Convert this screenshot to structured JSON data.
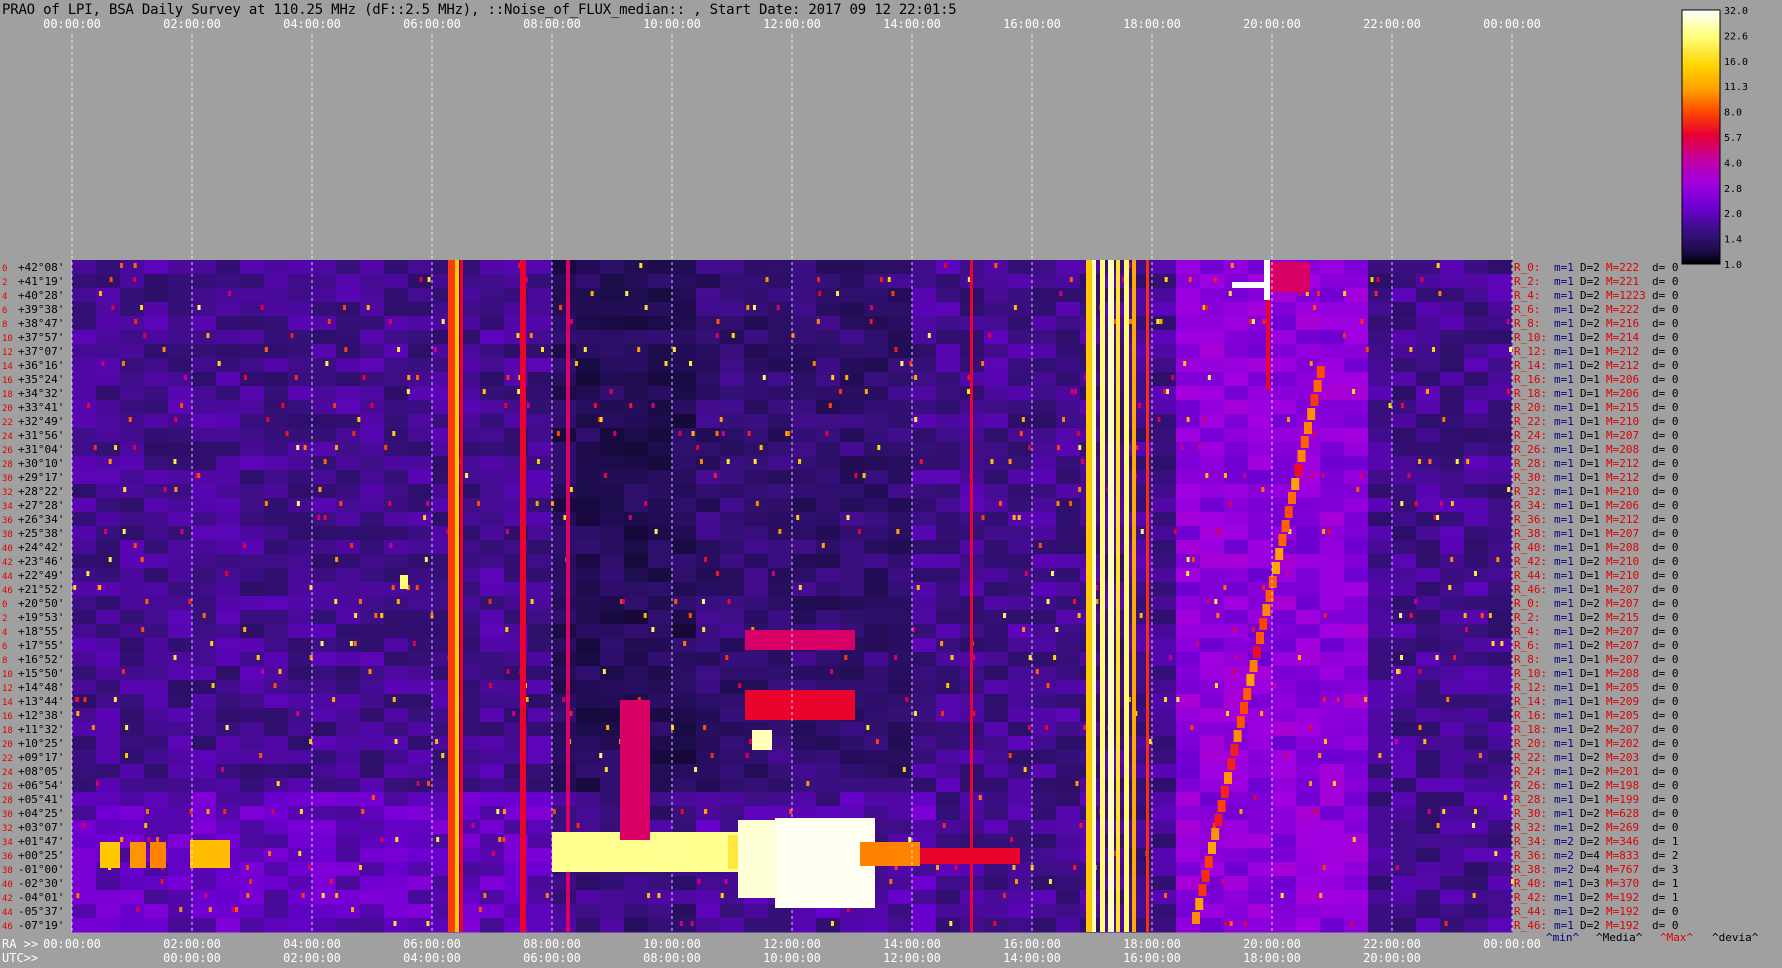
{
  "title": "PRAO of LPI, BSA Daily Survey at 110.25 MHz (dF::2.5 MHz), ::Noise_of_FLUX_median:: , Start Date: 2017 09 12 22:01:5",
  "time_axis": {
    "top_ticks": [
      "00:00:00",
      "02:00:00",
      "04:00:00",
      "06:00:00",
      "08:00:00",
      "10:00:00",
      "12:00:00",
      "14:00:00",
      "16:00:00",
      "18:00:00",
      "20:00:00",
      "22:00:00",
      "00:00:00"
    ],
    "ra_label": "RA >>",
    "ra_ticks": [
      "00:00:00",
      "02:00:00",
      "04:00:00",
      "06:00:00",
      "08:00:00",
      "10:00:00",
      "12:00:00",
      "14:00:00",
      "16:00:00",
      "18:00:00",
      "20:00:00",
      "22:00:00",
      "00:00:00"
    ],
    "utc_label": "UTC>>",
    "utc_ticks": [
      "00:00:00",
      "02:00:00",
      "04:00:00",
      "06:00:00",
      "08:00:00",
      "10:00:00",
      "12:00:00",
      "14:00:00",
      "16:00:00",
      "18:00:00",
      "20:00:00"
    ]
  },
  "row_indices": [
    "0",
    "2",
    "4",
    "6",
    "8",
    "10",
    "12",
    "14",
    "16",
    "18",
    "20",
    "22",
    "24",
    "26",
    "28",
    "30",
    "32",
    "34",
    "36",
    "38",
    "40",
    "42",
    "44",
    "46",
    "0",
    "2",
    "4",
    "6",
    "8",
    "10",
    "12",
    "14",
    "16",
    "18",
    "20",
    "22",
    "24",
    "26",
    "28",
    "30",
    "32",
    "34",
    "36",
    "38",
    "40",
    "42",
    "44",
    "46"
  ],
  "declinations": [
    "+42°08'",
    "+41°19'",
    "+40°28'",
    "+39°38'",
    "+38°47'",
    "+37°57'",
    "+37°07'",
    "+36°16'",
    "+35°24'",
    "+34°32'",
    "+33°41'",
    "+32°49'",
    "+31°56'",
    "+31°04'",
    "+30°10'",
    "+29°17'",
    "+28°22'",
    "+27°28'",
    "+26°34'",
    "+25°38'",
    "+24°42'",
    "+23°46'",
    "+22°49'",
    "+21°52'",
    "+20°50'",
    "+19°53'",
    "+18°55'",
    "+17°55'",
    "+16°52'",
    "+15°50'",
    "+14°48'",
    "+13°44'",
    "+12°38'",
    "+11°32'",
    "+10°25'",
    "+09°17'",
    "+08°05'",
    "+06°54'",
    "+05°41'",
    "+04°25'",
    "+03°07'",
    "+01°47'",
    "+00°25'",
    "-01°00'",
    "-02°30'",
    "-04°01'",
    "-05°37'",
    "-07°19'"
  ],
  "beam_stats": [
    {
      "r": "R_0:",
      "m": "m=1",
      "d": "D=2",
      "M": "M=222",
      "dev": "d= 0"
    },
    {
      "r": "R_2:",
      "m": "m=1",
      "d": "D=2",
      "M": "M=221",
      "dev": "d= 0"
    },
    {
      "r": "R_4:",
      "m": "m=1",
      "d": "D=2",
      "M": "M=1223",
      "dev": "d= 0"
    },
    {
      "r": "R_6:",
      "m": "m=1",
      "d": "D=2",
      "M": "M=222",
      "dev": "d= 0"
    },
    {
      "r": "R_8:",
      "m": "m=1",
      "d": "D=2",
      "M": "M=216",
      "dev": "d= 0"
    },
    {
      "r": "R_10:",
      "m": "m=1",
      "d": "D=2",
      "M": "M=214",
      "dev": "d= 0"
    },
    {
      "r": "R_12:",
      "m": "m=1",
      "d": "D=1",
      "M": "M=212",
      "dev": "d= 0"
    },
    {
      "r": "R_14:",
      "m": "m=1",
      "d": "D=2",
      "M": "M=212",
      "dev": "d= 0"
    },
    {
      "r": "R_16:",
      "m": "m=1",
      "d": "D=1",
      "M": "M=206",
      "dev": "d= 0"
    },
    {
      "r": "R_18:",
      "m": "m=1",
      "d": "D=1",
      "M": "M=206",
      "dev": "d= 0"
    },
    {
      "r": "R_20:",
      "m": "m=1",
      "d": "D=1",
      "M": "M=215",
      "dev": "d= 0"
    },
    {
      "r": "R_22:",
      "m": "m=1",
      "d": "D=1",
      "M": "M=210",
      "dev": "d= 0"
    },
    {
      "r": "R_24:",
      "m": "m=1",
      "d": "D=1",
      "M": "M=207",
      "dev": "d= 0"
    },
    {
      "r": "R_26:",
      "m": "m=1",
      "d": "D=1",
      "M": "M=208",
      "dev": "d= 0"
    },
    {
      "r": "R_28:",
      "m": "m=1",
      "d": "D=1",
      "M": "M=212",
      "dev": "d= 0"
    },
    {
      "r": "R_30:",
      "m": "m=1",
      "d": "D=1",
      "M": "M=212",
      "dev": "d= 0"
    },
    {
      "r": "R_32:",
      "m": "m=1",
      "d": "D=1",
      "M": "M=210",
      "dev": "d= 0"
    },
    {
      "r": "R_34:",
      "m": "m=1",
      "d": "D=1",
      "M": "M=206",
      "dev": "d= 0"
    },
    {
      "r": "R_36:",
      "m": "m=1",
      "d": "D=1",
      "M": "M=212",
      "dev": "d= 0"
    },
    {
      "r": "R_38:",
      "m": "m=1",
      "d": "D=1",
      "M": "M=207",
      "dev": "d= 0"
    },
    {
      "r": "R_40:",
      "m": "m=1",
      "d": "D=1",
      "M": "M=208",
      "dev": "d= 0"
    },
    {
      "r": "R_42:",
      "m": "m=1",
      "d": "D=2",
      "M": "M=210",
      "dev": "d= 0"
    },
    {
      "r": "R_44:",
      "m": "m=1",
      "d": "D=1",
      "M": "M=210",
      "dev": "d= 0"
    },
    {
      "r": "R_46:",
      "m": "m=1",
      "d": "D=1",
      "M": "M=207",
      "dev": "d= 0"
    },
    {
      "r": "R_0:",
      "m": "m=1",
      "d": "D=2",
      "M": "M=207",
      "dev": "d= 0"
    },
    {
      "r": "R_2:",
      "m": "m=1",
      "d": "D=2",
      "M": "M=215",
      "dev": "d= 0"
    },
    {
      "r": "R_4:",
      "m": "m=1",
      "d": "D=2",
      "M": "M=207",
      "dev": "d= 0"
    },
    {
      "r": "R_6:",
      "m": "m=1",
      "d": "D=2",
      "M": "M=207",
      "dev": "d= 0"
    },
    {
      "r": "R_8:",
      "m": "m=1",
      "d": "D=1",
      "M": "M=207",
      "dev": "d= 0"
    },
    {
      "r": "R_10:",
      "m": "m=1",
      "d": "D=1",
      "M": "M=208",
      "dev": "d= 0"
    },
    {
      "r": "R_12:",
      "m": "m=1",
      "d": "D=1",
      "M": "M=205",
      "dev": "d= 0"
    },
    {
      "r": "R_14:",
      "m": "m=1",
      "d": "D=1",
      "M": "M=209",
      "dev": "d= 0"
    },
    {
      "r": "R_16:",
      "m": "m=1",
      "d": "D=1",
      "M": "M=205",
      "dev": "d= 0"
    },
    {
      "r": "R_18:",
      "m": "m=1",
      "d": "D=2",
      "M": "M=207",
      "dev": "d= 0"
    },
    {
      "r": "R_20:",
      "m": "m=1",
      "d": "D=1",
      "M": "M=202",
      "dev": "d= 0"
    },
    {
      "r": "R_22:",
      "m": "m=1",
      "d": "D=2",
      "M": "M=203",
      "dev": "d= 0"
    },
    {
      "r": "R_24:",
      "m": "m=1",
      "d": "D=2",
      "M": "M=201",
      "dev": "d= 0"
    },
    {
      "r": "R_26:",
      "m": "m=1",
      "d": "D=2",
      "M": "M=198",
      "dev": "d= 0"
    },
    {
      "r": "R_28:",
      "m": "m=1",
      "d": "D=1",
      "M": "M=199",
      "dev": "d= 0"
    },
    {
      "r": "R_30:",
      "m": "m=1",
      "d": "D=2",
      "M": "M=628",
      "dev": "d= 0"
    },
    {
      "r": "R_32:",
      "m": "m=1",
      "d": "D=2",
      "M": "M=269",
      "dev": "d= 0"
    },
    {
      "r": "R_34:",
      "m": "m=2",
      "d": "D=2",
      "M": "M=346",
      "dev": "d= 1"
    },
    {
      "r": "R_36:",
      "m": "m=2",
      "d": "D=4",
      "M": "M=833",
      "dev": "d= 2"
    },
    {
      "r": "R_38:",
      "m": "m=2",
      "d": "D=4",
      "M": "M=767",
      "dev": "d= 3"
    },
    {
      "r": "R_40:",
      "m": "m=1",
      "d": "D=3",
      "M": "M=370",
      "dev": "d= 1"
    },
    {
      "r": "R_42:",
      "m": "m=1",
      "d": "D=2",
      "M": "M=192",
      "dev": "d= 1"
    },
    {
      "r": "R_44:",
      "m": "m=1",
      "d": "D=2",
      "M": "M=192",
      "dev": "d= 0"
    },
    {
      "r": "R_46:",
      "m": "m=1",
      "d": "D=2",
      "M": "M=192",
      "dev": "d= 0"
    }
  ],
  "stats_legend": {
    "min": "^min^",
    "median": "^Media^",
    "max": "^Max^",
    "dev": "^devia^"
  },
  "colors": {
    "background": "#a0a0a0",
    "label_red": "#e00000",
    "label_navy": "#000080",
    "grid": "#ffffff",
    "dec_label": "#000000"
  },
  "colorbar": {
    "ticks": [
      "32.0",
      "22.6",
      "16.0",
      "11.3",
      "8.0",
      "5.7",
      "4.0",
      "2.8",
      "2.0",
      "1.4",
      "1.0"
    ],
    "palette": [
      "#ffffff",
      "#ffff80",
      "#ffd400",
      "#ff9a00",
      "#ff4a00",
      "#e80030",
      "#c8009a",
      "#a000e0",
      "#6a00d0",
      "#36107a",
      "#1c0c4a",
      "#000000"
    ]
  },
  "chart_data": {
    "type": "heatmap",
    "xlabel": "RA",
    "x_ticks": [
      "00:00:00",
      "02:00:00",
      "04:00:00",
      "06:00:00",
      "08:00:00",
      "10:00:00",
      "12:00:00",
      "14:00:00",
      "16:00:00",
      "18:00:00",
      "20:00:00",
      "22:00:00",
      "00:00:00"
    ],
    "y_ticks_dec": [
      "+42°08'",
      "+41°19'",
      "+40°28'",
      "+39°38'",
      "+38°47'",
      "+37°57'",
      "+37°07'",
      "+36°16'",
      "+35°24'",
      "+34°32'",
      "+33°41'",
      "+32°49'",
      "+31°56'",
      "+31°04'",
      "+30°10'",
      "+29°17'",
      "+28°22'",
      "+27°28'",
      "+26°34'",
      "+25°38'",
      "+24°42'",
      "+23°46'",
      "+22°49'",
      "+21°52'",
      "+20°50'",
      "+19°53'",
      "+18°55'",
      "+17°55'",
      "+16°52'",
      "+15°50'",
      "+14°48'",
      "+13°44'",
      "+12°38'",
      "+11°32'",
      "+10°25'",
      "+09°17'",
      "+08°05'",
      "+06°54'",
      "+05°41'",
      "+04°25'",
      "+03°07'",
      "+01°47'",
      "+00°25'",
      "-01°00'",
      "-02°30'",
      "-04°01'",
      "-05°37'",
      "-07°19'"
    ],
    "color_scale": [
      1.0,
      32.0
    ],
    "scale": "log2"
  }
}
